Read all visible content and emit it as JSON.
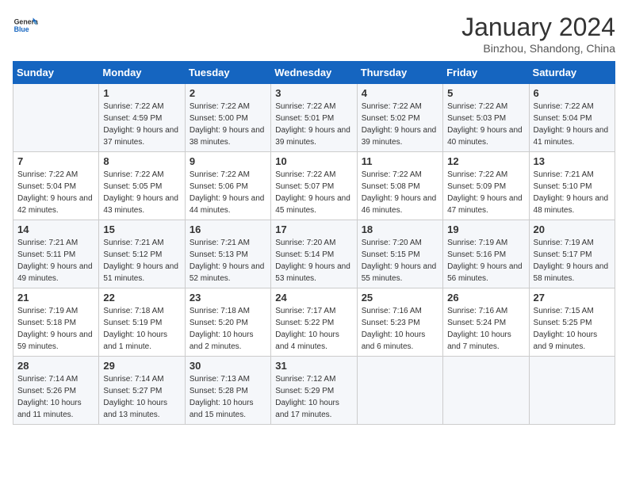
{
  "header": {
    "logo_general": "General",
    "logo_blue": "Blue",
    "month_year": "January 2024",
    "location": "Binzhou, Shandong, China"
  },
  "days_of_week": [
    "Sunday",
    "Monday",
    "Tuesday",
    "Wednesday",
    "Thursday",
    "Friday",
    "Saturday"
  ],
  "weeks": [
    [
      {
        "day": "",
        "sunrise": "",
        "sunset": "",
        "daylight": ""
      },
      {
        "day": "1",
        "sunrise": "Sunrise: 7:22 AM",
        "sunset": "Sunset: 4:59 PM",
        "daylight": "Daylight: 9 hours and 37 minutes."
      },
      {
        "day": "2",
        "sunrise": "Sunrise: 7:22 AM",
        "sunset": "Sunset: 5:00 PM",
        "daylight": "Daylight: 9 hours and 38 minutes."
      },
      {
        "day": "3",
        "sunrise": "Sunrise: 7:22 AM",
        "sunset": "Sunset: 5:01 PM",
        "daylight": "Daylight: 9 hours and 39 minutes."
      },
      {
        "day": "4",
        "sunrise": "Sunrise: 7:22 AM",
        "sunset": "Sunset: 5:02 PM",
        "daylight": "Daylight: 9 hours and 39 minutes."
      },
      {
        "day": "5",
        "sunrise": "Sunrise: 7:22 AM",
        "sunset": "Sunset: 5:03 PM",
        "daylight": "Daylight: 9 hours and 40 minutes."
      },
      {
        "day": "6",
        "sunrise": "Sunrise: 7:22 AM",
        "sunset": "Sunset: 5:04 PM",
        "daylight": "Daylight: 9 hours and 41 minutes."
      }
    ],
    [
      {
        "day": "7",
        "sunrise": "Sunrise: 7:22 AM",
        "sunset": "Sunset: 5:04 PM",
        "daylight": "Daylight: 9 hours and 42 minutes."
      },
      {
        "day": "8",
        "sunrise": "Sunrise: 7:22 AM",
        "sunset": "Sunset: 5:05 PM",
        "daylight": "Daylight: 9 hours and 43 minutes."
      },
      {
        "day": "9",
        "sunrise": "Sunrise: 7:22 AM",
        "sunset": "Sunset: 5:06 PM",
        "daylight": "Daylight: 9 hours and 44 minutes."
      },
      {
        "day": "10",
        "sunrise": "Sunrise: 7:22 AM",
        "sunset": "Sunset: 5:07 PM",
        "daylight": "Daylight: 9 hours and 45 minutes."
      },
      {
        "day": "11",
        "sunrise": "Sunrise: 7:22 AM",
        "sunset": "Sunset: 5:08 PM",
        "daylight": "Daylight: 9 hours and 46 minutes."
      },
      {
        "day": "12",
        "sunrise": "Sunrise: 7:22 AM",
        "sunset": "Sunset: 5:09 PM",
        "daylight": "Daylight: 9 hours and 47 minutes."
      },
      {
        "day": "13",
        "sunrise": "Sunrise: 7:21 AM",
        "sunset": "Sunset: 5:10 PM",
        "daylight": "Daylight: 9 hours and 48 minutes."
      }
    ],
    [
      {
        "day": "14",
        "sunrise": "Sunrise: 7:21 AM",
        "sunset": "Sunset: 5:11 PM",
        "daylight": "Daylight: 9 hours and 49 minutes."
      },
      {
        "day": "15",
        "sunrise": "Sunrise: 7:21 AM",
        "sunset": "Sunset: 5:12 PM",
        "daylight": "Daylight: 9 hours and 51 minutes."
      },
      {
        "day": "16",
        "sunrise": "Sunrise: 7:21 AM",
        "sunset": "Sunset: 5:13 PM",
        "daylight": "Daylight: 9 hours and 52 minutes."
      },
      {
        "day": "17",
        "sunrise": "Sunrise: 7:20 AM",
        "sunset": "Sunset: 5:14 PM",
        "daylight": "Daylight: 9 hours and 53 minutes."
      },
      {
        "day": "18",
        "sunrise": "Sunrise: 7:20 AM",
        "sunset": "Sunset: 5:15 PM",
        "daylight": "Daylight: 9 hours and 55 minutes."
      },
      {
        "day": "19",
        "sunrise": "Sunrise: 7:19 AM",
        "sunset": "Sunset: 5:16 PM",
        "daylight": "Daylight: 9 hours and 56 minutes."
      },
      {
        "day": "20",
        "sunrise": "Sunrise: 7:19 AM",
        "sunset": "Sunset: 5:17 PM",
        "daylight": "Daylight: 9 hours and 58 minutes."
      }
    ],
    [
      {
        "day": "21",
        "sunrise": "Sunrise: 7:19 AM",
        "sunset": "Sunset: 5:18 PM",
        "daylight": "Daylight: 9 hours and 59 minutes."
      },
      {
        "day": "22",
        "sunrise": "Sunrise: 7:18 AM",
        "sunset": "Sunset: 5:19 PM",
        "daylight": "Daylight: 10 hours and 1 minute."
      },
      {
        "day": "23",
        "sunrise": "Sunrise: 7:18 AM",
        "sunset": "Sunset: 5:20 PM",
        "daylight": "Daylight: 10 hours and 2 minutes."
      },
      {
        "day": "24",
        "sunrise": "Sunrise: 7:17 AM",
        "sunset": "Sunset: 5:22 PM",
        "daylight": "Daylight: 10 hours and 4 minutes."
      },
      {
        "day": "25",
        "sunrise": "Sunrise: 7:16 AM",
        "sunset": "Sunset: 5:23 PM",
        "daylight": "Daylight: 10 hours and 6 minutes."
      },
      {
        "day": "26",
        "sunrise": "Sunrise: 7:16 AM",
        "sunset": "Sunset: 5:24 PM",
        "daylight": "Daylight: 10 hours and 7 minutes."
      },
      {
        "day": "27",
        "sunrise": "Sunrise: 7:15 AM",
        "sunset": "Sunset: 5:25 PM",
        "daylight": "Daylight: 10 hours and 9 minutes."
      }
    ],
    [
      {
        "day": "28",
        "sunrise": "Sunrise: 7:14 AM",
        "sunset": "Sunset: 5:26 PM",
        "daylight": "Daylight: 10 hours and 11 minutes."
      },
      {
        "day": "29",
        "sunrise": "Sunrise: 7:14 AM",
        "sunset": "Sunset: 5:27 PM",
        "daylight": "Daylight: 10 hours and 13 minutes."
      },
      {
        "day": "30",
        "sunrise": "Sunrise: 7:13 AM",
        "sunset": "Sunset: 5:28 PM",
        "daylight": "Daylight: 10 hours and 15 minutes."
      },
      {
        "day": "31",
        "sunrise": "Sunrise: 7:12 AM",
        "sunset": "Sunset: 5:29 PM",
        "daylight": "Daylight: 10 hours and 17 minutes."
      },
      {
        "day": "",
        "sunrise": "",
        "sunset": "",
        "daylight": ""
      },
      {
        "day": "",
        "sunrise": "",
        "sunset": "",
        "daylight": ""
      },
      {
        "day": "",
        "sunrise": "",
        "sunset": "",
        "daylight": ""
      }
    ]
  ]
}
